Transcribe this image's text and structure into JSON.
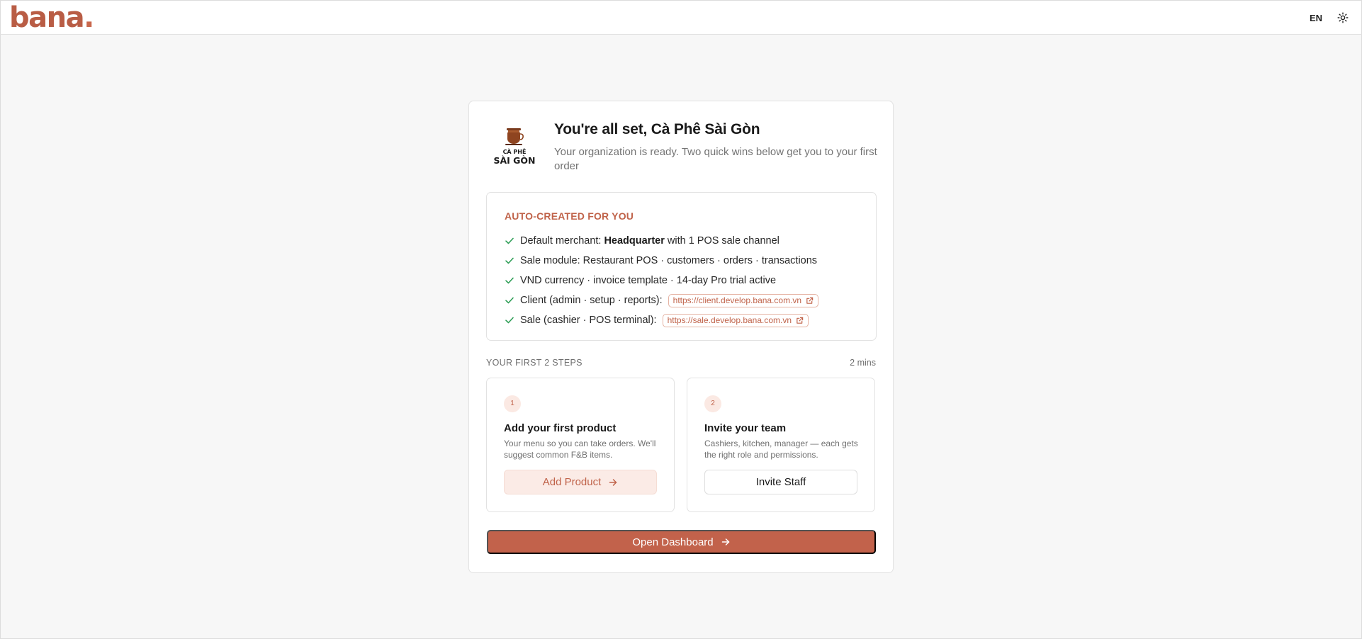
{
  "header": {
    "logo_text": "bana",
    "logo_dot": ".",
    "language": "EN",
    "theme_icon": "sun-icon"
  },
  "colors": {
    "brand": "#c2624b",
    "accent_text": "#c0634a",
    "background": "#f7f7f7"
  },
  "welcome": {
    "org_logo_line1": "CÀ PHÊ",
    "org_logo_line2": "SÀI GÒN",
    "title": "You're all set, Cà Phê Sài Gòn",
    "subtitle": "Your organization is ready. Two quick wins below get you to your first order"
  },
  "auto_created": {
    "title": "AUTO-CREATED FOR YOU",
    "items": [
      {
        "prefix": "Default merchant:",
        "bold": "Headquarter",
        "suffix": "with 1 POS sale channel"
      },
      {
        "text": "Sale module: Restaurant POS · customers · orders · transactions"
      },
      {
        "text": "VND currency · invoice template · 14-day Pro trial active"
      },
      {
        "text": "Client (admin · setup · reports):",
        "link": "https://client.develop.bana.com.vn"
      },
      {
        "text": "Sale (cashier · POS terminal):",
        "link": "https://sale.develop.bana.com.vn"
      }
    ]
  },
  "steps": {
    "heading": "YOUR FIRST 2 STEPS",
    "duration": "2 mins",
    "items": [
      {
        "number": "1",
        "title": "Add your first product",
        "description": "Your menu so you can take orders. We'll suggest common F&B items.",
        "button": "Add Product"
      },
      {
        "number": "2",
        "title": "Invite your team",
        "description": "Cashiers, kitchen, manager — each gets the right role and permissions.",
        "button": "Invite Staff"
      }
    ]
  },
  "footer": {
    "dashboard_button": "Open Dashboard"
  }
}
